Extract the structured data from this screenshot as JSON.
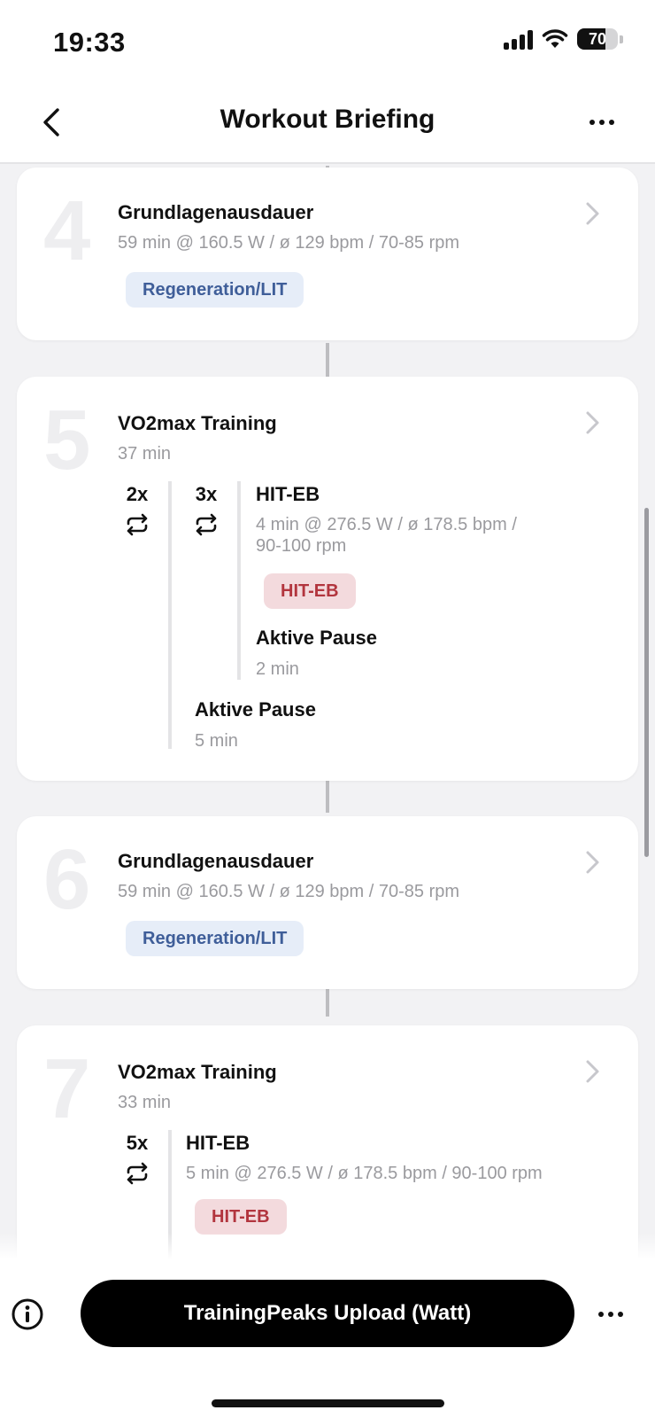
{
  "status_bar": {
    "time": "19:33",
    "battery_level": 70,
    "battery_label": "70"
  },
  "nav": {
    "title": "Workout Briefing",
    "back_icon": "chevron-left-icon",
    "more_icon": "ellipsis-icon"
  },
  "steps": [
    {
      "number": "4",
      "title": "Grundlagenausdauer",
      "subtitle": "59 min @ 160.5 W / ø 129 bpm / 70-85 rpm",
      "tag": "Regeneration/LIT"
    },
    {
      "number": "5",
      "title": "VO2max Training",
      "subtitle": "37 min",
      "outer_repeat": "2x",
      "inner_repeat": "3x",
      "intervals": [
        {
          "title": "HIT-EB",
          "line1": "4 min @ 276.5 W / ø 178.5 bpm /",
          "line2": "90-100 rpm",
          "tag": "HIT-EB"
        },
        {
          "title": "Aktive Pause",
          "subtitle": "2 min"
        }
      ],
      "outer_pause": {
        "title": "Aktive Pause",
        "subtitle": "5 min"
      }
    },
    {
      "number": "6",
      "title": "Grundlagenausdauer",
      "subtitle": "59 min @ 160.5 W / ø 129 bpm / 70-85 rpm",
      "tag": "Regeneration/LIT"
    },
    {
      "number": "7",
      "title": "VO2max Training",
      "subtitle": "33 min",
      "repeat": "5x",
      "intervals": [
        {
          "title": "HIT-EB",
          "subtitle": "5 min @ 276.5 W / ø 178.5 bpm / 90-100 rpm",
          "tag": "HIT-EB"
        }
      ]
    }
  ],
  "bottom_bar": {
    "primary_button": "TrainingPeaks Upload (Watt)",
    "info_icon": "info-icon",
    "more_icon": "ellipsis-icon"
  },
  "colors": {
    "lit_tag_bg": "#e6edf8",
    "lit_tag_text": "#3f5e99",
    "hit_tag_bg": "#f3dadd",
    "hit_tag_text": "#b2353e"
  }
}
